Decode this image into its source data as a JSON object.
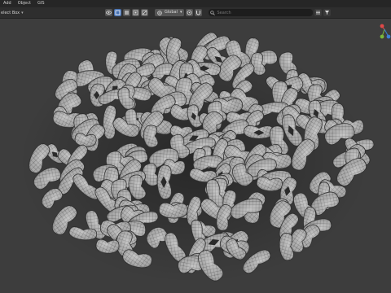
{
  "menubar": {
    "items": [
      "Add",
      "Object",
      "GIS"
    ]
  },
  "toolbar": {
    "select_mode": "elect Box",
    "pivot": "Global",
    "search_placeholder": "Search"
  },
  "icons": {
    "search": "search-icon",
    "filter": "filter-icon",
    "snap": "magnet-icon"
  },
  "colors": {
    "background": "#3d3d3d",
    "menubar": "#262626",
    "accent": "#4772b3",
    "axis_x": "#e04848",
    "axis_y": "#7ab83a",
    "axis_z": "#3b7fd6"
  }
}
